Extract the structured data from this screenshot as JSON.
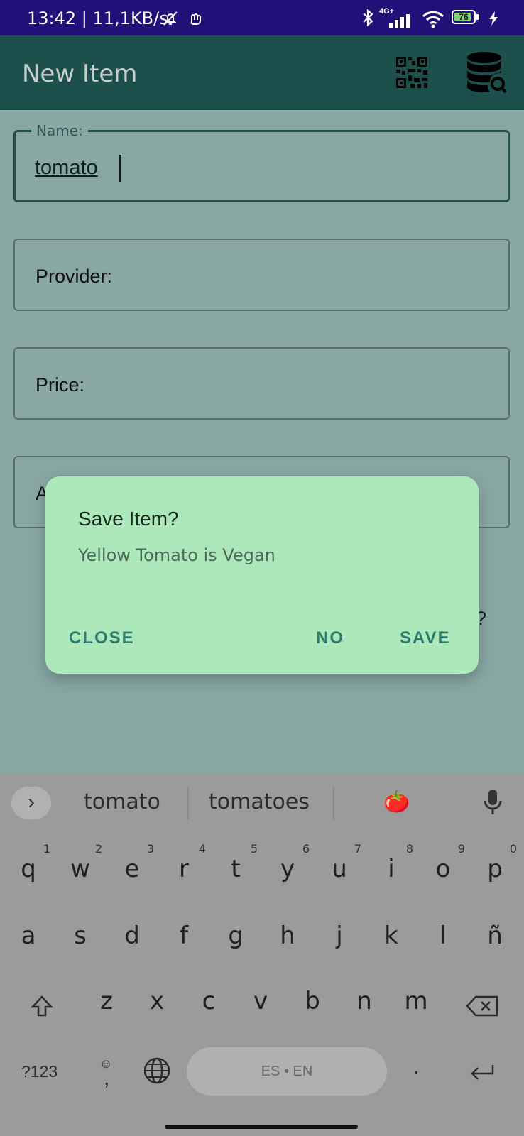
{
  "status_bar": {
    "time_speed": "13:42 | 11,1KB/s",
    "network": "4G+",
    "battery_level": "76"
  },
  "app_bar": {
    "title": "New Item",
    "actions": [
      "qr-code-icon",
      "database-search-icon"
    ]
  },
  "form": {
    "name_label": "Name:",
    "name_value": "tomato",
    "provider_label": "Provider:",
    "price_label": "Price:",
    "fourth_label_partial": "A",
    "edge_fragment": "?"
  },
  "dialog": {
    "title": "Save Item?",
    "message": "Yellow Tomato is Vegan",
    "btn_close": "CLOSE",
    "btn_no": "NO",
    "btn_save": "SAVE"
  },
  "keyboard": {
    "suggestions": [
      "tomato",
      "tomatoes",
      "🍅"
    ],
    "row1": [
      "q",
      "w",
      "e",
      "r",
      "t",
      "y",
      "u",
      "i",
      "o",
      "p"
    ],
    "row1_hints": [
      "1",
      "2",
      "3",
      "4",
      "5",
      "6",
      "7",
      "8",
      "9",
      "0"
    ],
    "row2": [
      "a",
      "s",
      "d",
      "f",
      "g",
      "h",
      "j",
      "k",
      "l",
      "ñ"
    ],
    "row3": [
      "z",
      "x",
      "c",
      "v",
      "b",
      "n",
      "m"
    ],
    "symbols_key": "?123",
    "comma_key": ",",
    "period_key": ".",
    "space_label": "ES • EN"
  },
  "colors": {
    "status_bar": "#23117a",
    "app_bar": "#1d4f4c",
    "scrim_bg": "#89a8a4",
    "dialog_bg": "#ade8bb",
    "dialog_button": "#2e7c70"
  }
}
